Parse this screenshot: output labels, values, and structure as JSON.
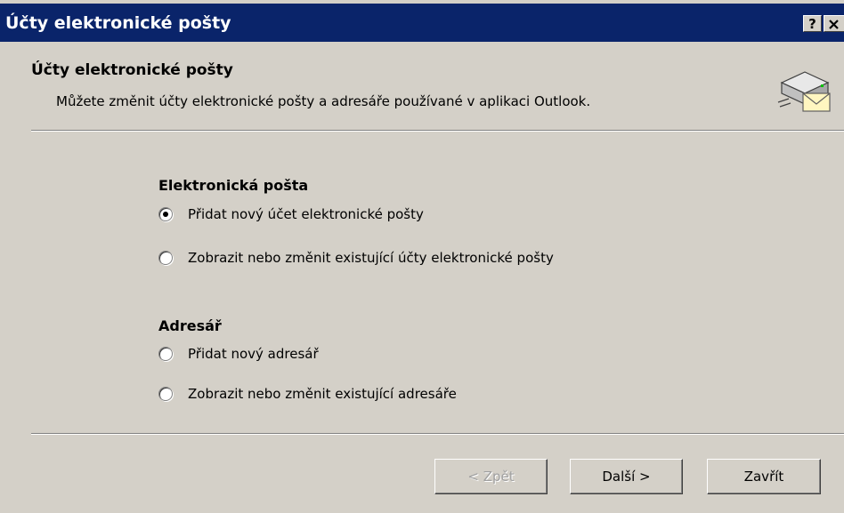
{
  "window": {
    "title": "Účty elektronické pošty",
    "help_label": "?",
    "close_label": "×"
  },
  "header": {
    "title": "Účty elektronické pošty",
    "subtitle": "Můžete změnit účty elektronické pošty a adresáře používané v aplikaci Outlook.",
    "icon": "mail-server-icon"
  },
  "groups": [
    {
      "label": "Elektronická pošta",
      "options": [
        {
          "label": "Přidat nový účet elektronické pošty",
          "checked": true
        },
        {
          "label": "Zobrazit nebo změnit existující účty elektronické pošty",
          "checked": false
        }
      ]
    },
    {
      "label": "Adresář",
      "options": [
        {
          "label": "Přidat nový adresář",
          "checked": false
        },
        {
          "label": "Zobrazit nebo změnit existující adresáře",
          "checked": false
        }
      ]
    }
  ],
  "buttons": {
    "back": {
      "label": "< Zpět",
      "enabled": false
    },
    "next": {
      "label": "Další >",
      "enabled": true
    },
    "close": {
      "label": "Zavřít",
      "enabled": true
    }
  },
  "colors": {
    "titlebar": "#0a246a",
    "face": "#d4d0c8"
  }
}
